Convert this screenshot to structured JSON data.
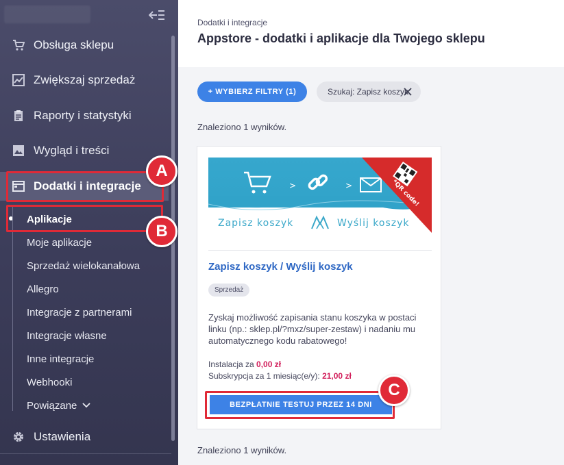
{
  "sidebar": {
    "items": [
      {
        "label": "Obsługa sklepu",
        "icon": "cart-icon"
      },
      {
        "label": "Zwiększaj sprzedaż",
        "icon": "chart-icon"
      },
      {
        "label": "Raporty i statystyki",
        "icon": "clipboard-icon"
      },
      {
        "label": "Wygląd i treści",
        "icon": "image-icon"
      },
      {
        "label": "Dodatki i integracje",
        "icon": "window-icon"
      },
      {
        "label": "Ustawienia",
        "icon": "gear-icon"
      }
    ],
    "sub_items": [
      {
        "label": "Aplikacje"
      },
      {
        "label": "Moje aplikacje"
      },
      {
        "label": "Sprzedaż wielokanałowa"
      },
      {
        "label": "Allegro"
      },
      {
        "label": "Integracje z partnerami"
      },
      {
        "label": "Integracje własne"
      },
      {
        "label": "Inne integracje"
      },
      {
        "label": "Webhooki"
      },
      {
        "label": "Powiązane"
      }
    ]
  },
  "header": {
    "breadcrumb": "Dodatki i integracje",
    "title": "Appstore - dodatki i aplikacje dla Twojego sklepu"
  },
  "filters": {
    "button_label": "+ WYBIERZ FILTRY (1)",
    "chip_label": "Szukaj: Zapisz koszyk"
  },
  "results": {
    "found_top": "Znaleziono 1 wyników.",
    "found_bottom": "Znaleziono 1 wyników."
  },
  "app": {
    "banner_left": "Zapisz koszyk",
    "banner_right": "Wyślij koszyk",
    "banner_corner": "*QR code!",
    "name": "Zapisz koszyk / Wyślij koszyk",
    "tag": "Sprzedaż",
    "description": "Zyskaj możliwość zapisania stanu koszyka w postaci linku (np.: sklep.pl/?mxz/super-zestaw) i nadaniu mu automatycznego kodu rabatowego!",
    "install_label": "Instalacja za",
    "install_price": "0,00 zł",
    "subscription_label": "Subskrypcja za 1 miesiąc(e/y):",
    "subscription_price": "21,00 zł",
    "cta_label": "BEZPŁATNIE TESTUJ PRZEZ 14 DNI"
  },
  "annotations": {
    "a": "A",
    "b": "B",
    "c": "C",
    "color": "#e02a37"
  },
  "colors": {
    "accent": "#3d82e6",
    "price": "#d11d5a",
    "sidebar": "#45465f"
  }
}
